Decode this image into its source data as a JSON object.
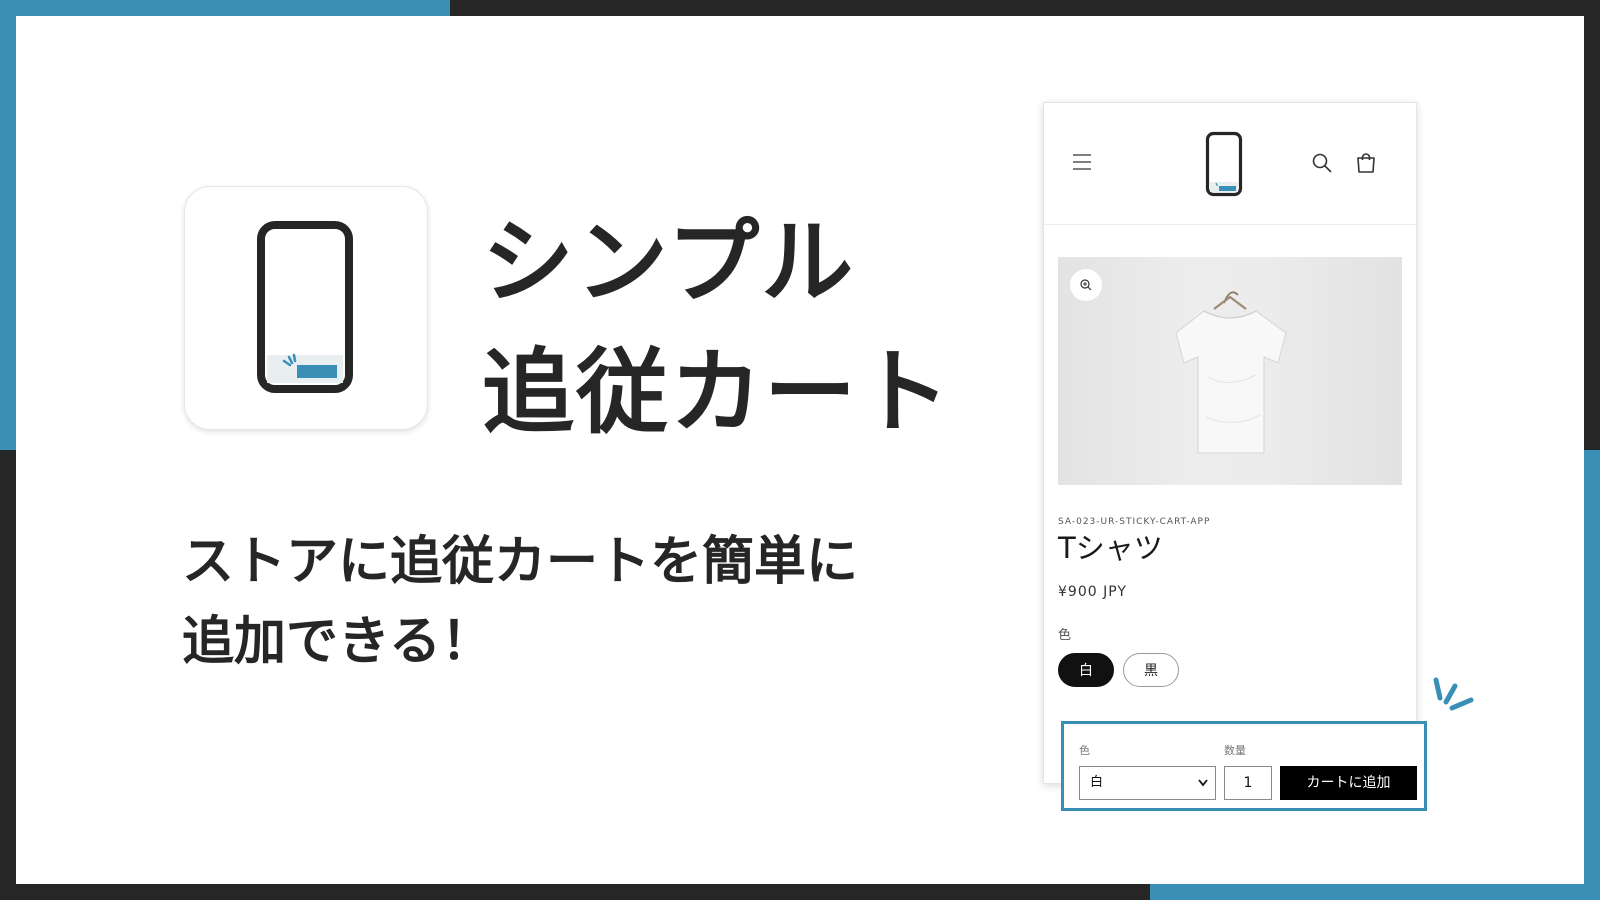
{
  "colors": {
    "accent": "#3a8fb7",
    "dark": "#262626",
    "background": "#ffffff"
  },
  "hero": {
    "title_lines": [
      "シンプル",
      "追従カート"
    ],
    "subtitle_lines": [
      "ストアに追従カートを簡単に",
      "追加できる！"
    ],
    "app_icon": "phone-sticky-cart-icon"
  },
  "shop": {
    "header_icons": [
      "hamburger-menu-icon",
      "store-logo-phone-icon",
      "search-icon",
      "cart-bag-icon"
    ],
    "product": {
      "image": "white-tshirt-on-hanger",
      "sku": "SA-023-UR-STICKY-CART-APP",
      "title": "Tシャツ",
      "price": "¥900 JPY",
      "color_label": "色",
      "color_options": [
        "白",
        "黒"
      ],
      "selected_color": "白"
    }
  },
  "sticky_cart": {
    "color_label": "色",
    "quantity_label": "数量",
    "selected_color": "白",
    "quantity": "1",
    "add_to_cart_label": "カートに追加"
  }
}
